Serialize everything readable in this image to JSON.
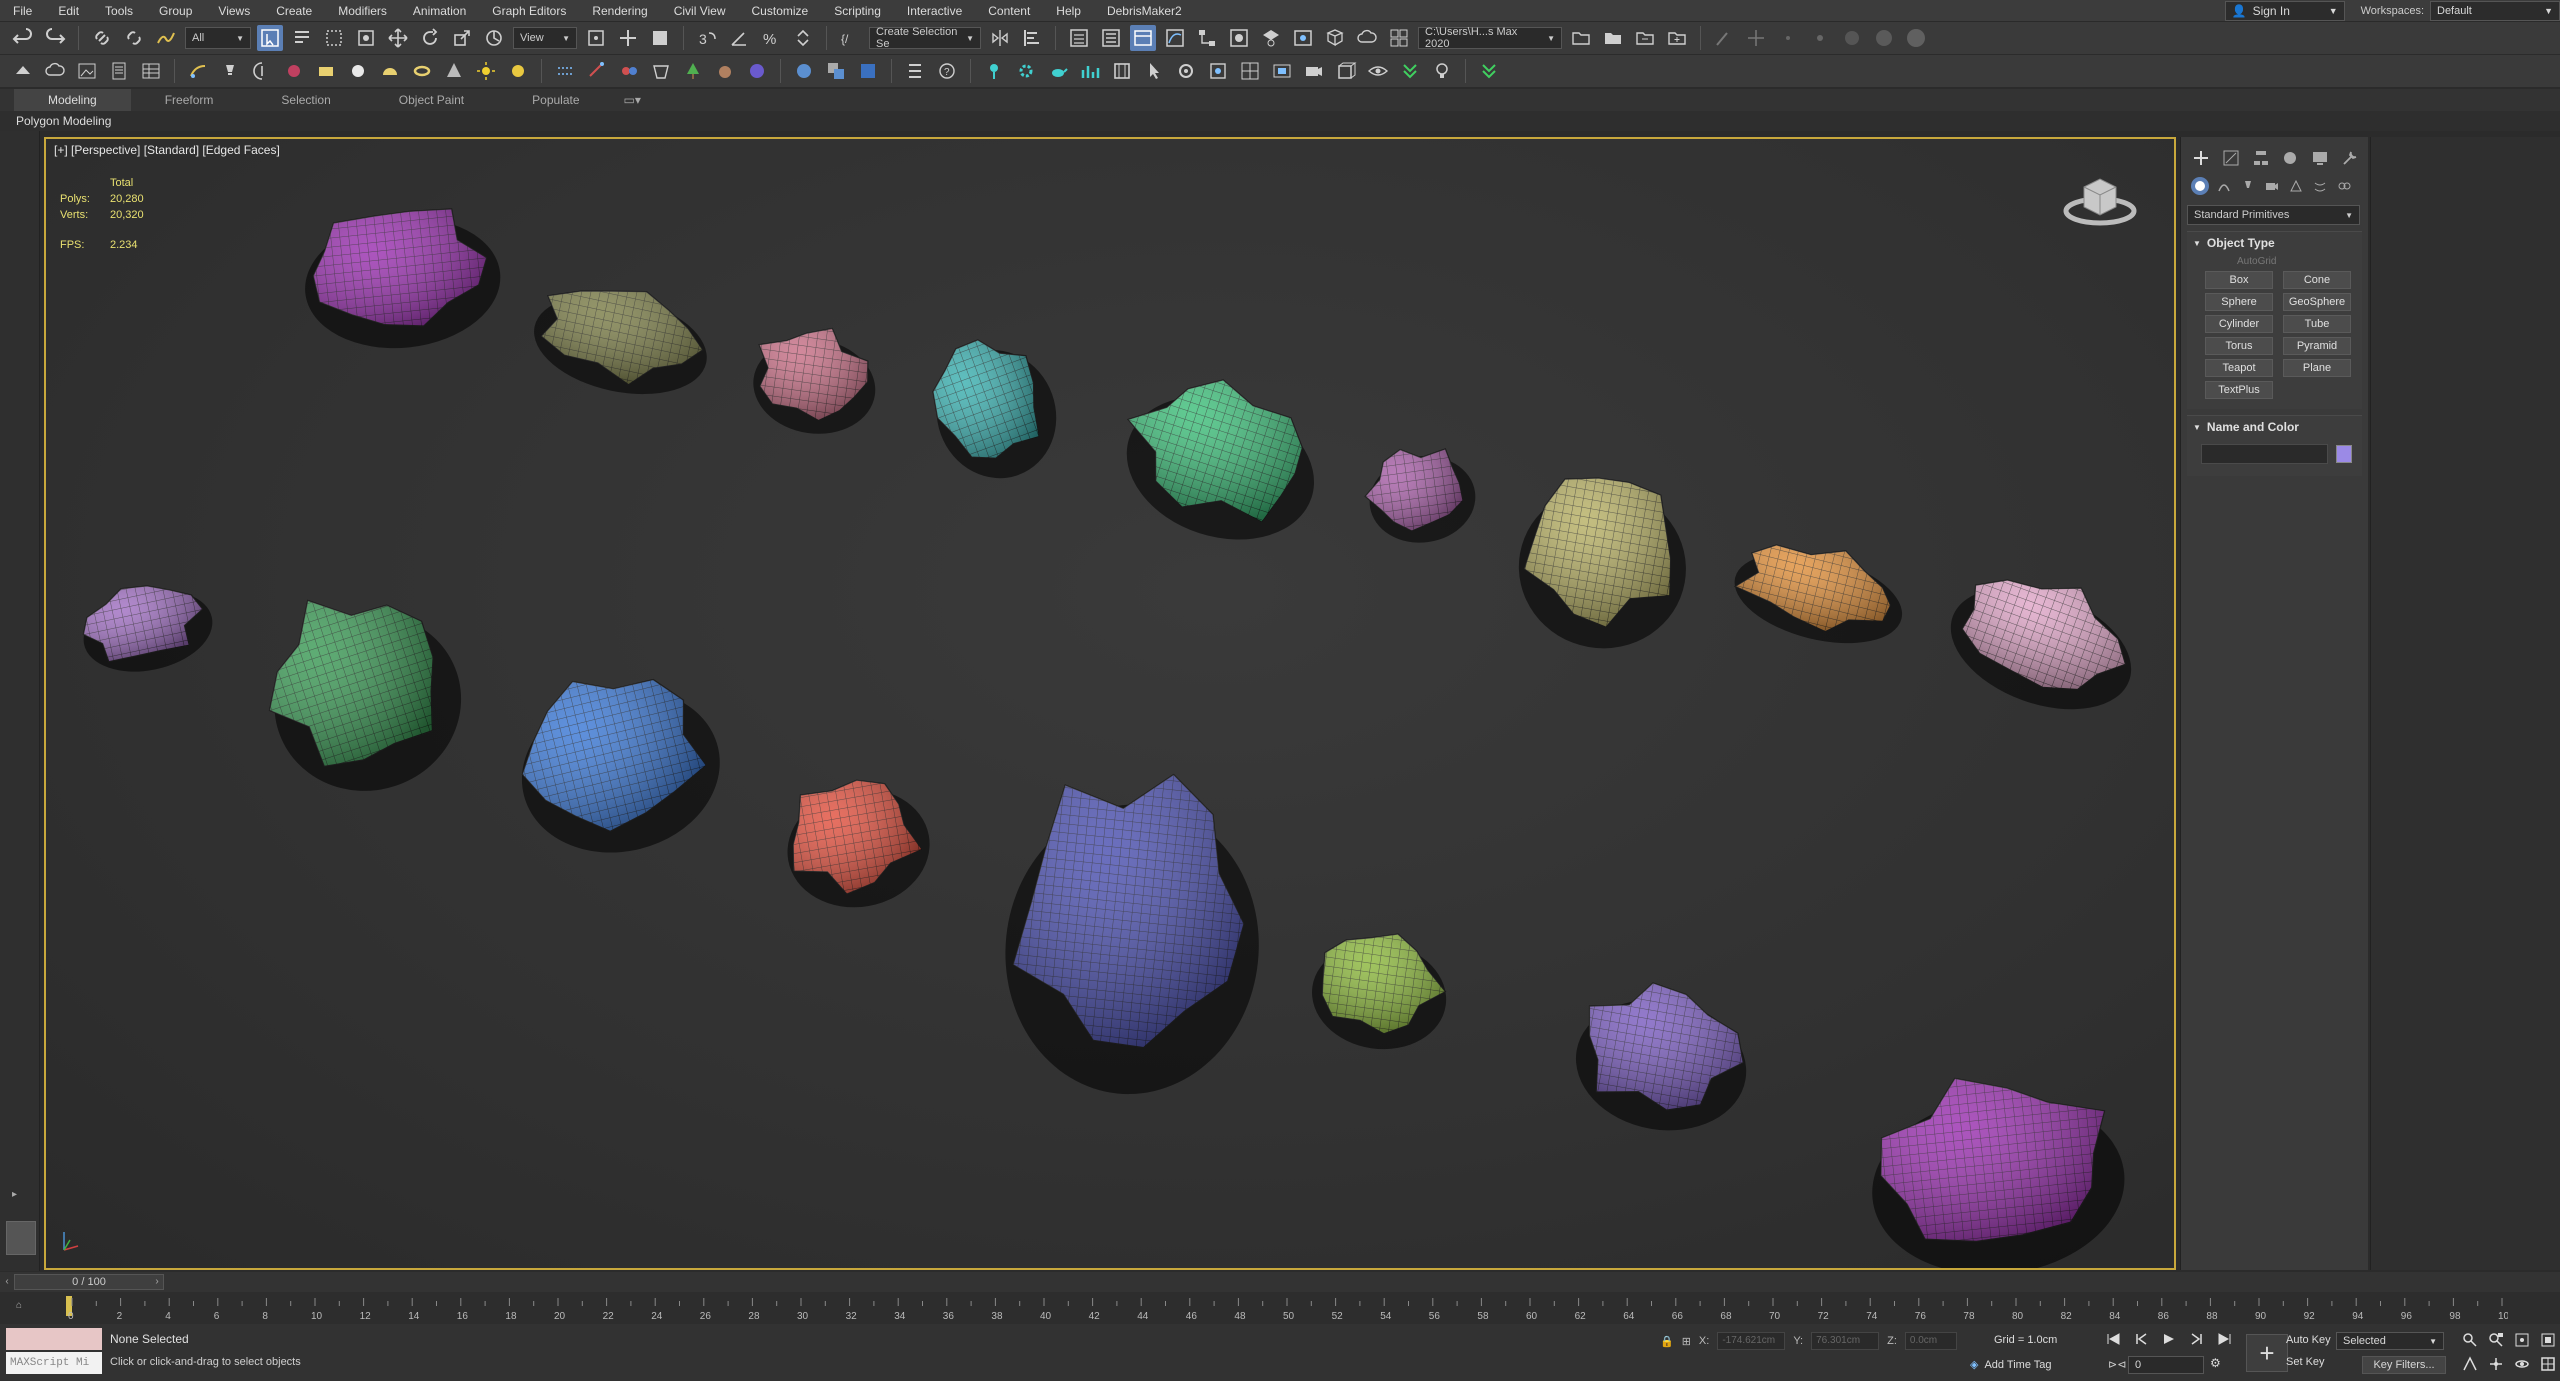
{
  "menu": {
    "items": [
      "File",
      "Edit",
      "Tools",
      "Group",
      "Views",
      "Create",
      "Modifiers",
      "Animation",
      "Graph Editors",
      "Rendering",
      "Civil View",
      "Customize",
      "Scripting",
      "Interactive",
      "Content",
      "Help",
      "DebrisMaker2"
    ],
    "sign_in": "Sign In",
    "workspaces_label": "Workspaces:",
    "workspace_value": "Default"
  },
  "toolbar": {
    "filter_value": "All",
    "view_value": "View",
    "selection_set_placeholder": "Create Selection Se",
    "project_path": "C:\\Users\\H...s Max 2020"
  },
  "ribbon": {
    "tabs": [
      "Modeling",
      "Freeform",
      "Selection",
      "Object Paint",
      "Populate"
    ],
    "active_tab": "Modeling",
    "sub_label": "Polygon Modeling"
  },
  "viewport": {
    "label": "[+] [Perspective] [Standard] [Edged Faces]",
    "stats": {
      "total_label": "Total",
      "polys_label": "Polys:",
      "polys_value": "20,280",
      "verts_label": "Verts:",
      "verts_value": "20,320",
      "fps_label": "FPS:",
      "fps_value": "2.234"
    },
    "rock_colors": [
      "#9a2fb0",
      "#7b7d47",
      "#c86f86",
      "#3ab0b0",
      "#3dbf7a",
      "#a85fa8",
      "#b7b064",
      "#e08f3a",
      "#e0a6c8",
      "#a06fc2",
      "#3a9a55",
      "#3a78d6",
      "#e2503e",
      "#4a4fb0",
      "#8cb83c",
      "#7a5cc0"
    ]
  },
  "command_panel": {
    "dropdown": "Standard Primitives",
    "object_type_title": "Object Type",
    "autogrid_label": "AutoGrid",
    "buttons": [
      "Box",
      "Cone",
      "Sphere",
      "GeoSphere",
      "Cylinder",
      "Tube",
      "Torus",
      "Pyramid",
      "Teapot",
      "Plane",
      "TextPlus"
    ],
    "name_color_title": "Name and Color",
    "swatch_color": "#9b8ae6"
  },
  "timeline": {
    "slider_text": "0 / 100",
    "ticks": [
      "0",
      "2",
      "4",
      "6",
      "8",
      "10",
      "12",
      "14",
      "16",
      "18",
      "20",
      "22",
      "24",
      "26",
      "28",
      "30",
      "32",
      "34",
      "36",
      "38",
      "40",
      "42",
      "44",
      "46",
      "48",
      "50",
      "52",
      "54",
      "56",
      "58",
      "60",
      "62",
      "64",
      "66",
      "68",
      "70",
      "72",
      "74",
      "76",
      "78",
      "80",
      "82",
      "84",
      "86",
      "88",
      "90",
      "92",
      "94",
      "96",
      "98",
      "100"
    ]
  },
  "status": {
    "maxscript_label": "MAXScript Mi",
    "selection_status": "None Selected",
    "prompt": "Click or click-and-drag to select objects",
    "x_label": "X:",
    "x_value": "-174.621cm",
    "y_label": "Y:",
    "y_value": "76.301cm",
    "z_label": "Z:",
    "z_value": "0.0cm",
    "grid": "Grid = 1.0cm",
    "add_time_tag": "Add Time Tag",
    "frame_value": "0",
    "auto_key": "Auto Key",
    "set_key": "Set Key",
    "selected_dropdown": "Selected",
    "key_filters": "Key Filters..."
  }
}
